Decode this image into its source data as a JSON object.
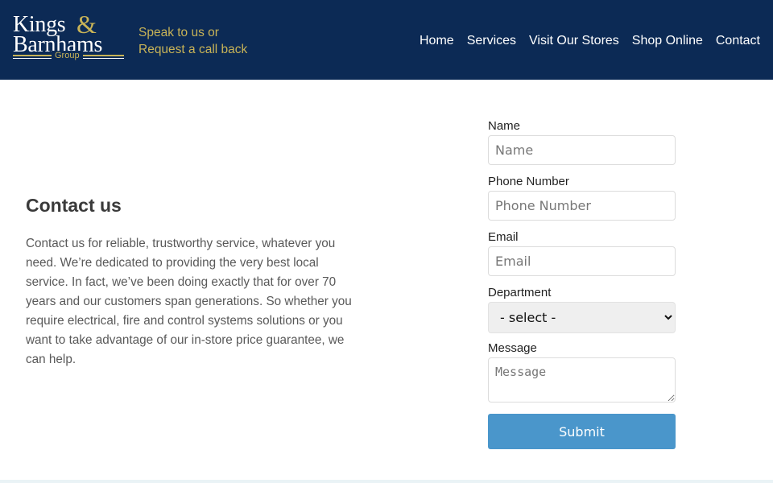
{
  "header": {
    "logo": {
      "line1": "Kings",
      "ampersand": "&",
      "line2": "Barnhams",
      "group": "Group"
    },
    "callback": {
      "line1": "Speak to us or",
      "line2": "Request a call back"
    },
    "nav": [
      {
        "label": "Home"
      },
      {
        "label": "Services"
      },
      {
        "label": "Visit Our Stores"
      },
      {
        "label": "Shop Online"
      },
      {
        "label": "Contact"
      }
    ]
  },
  "main": {
    "heading": "Contact us",
    "paragraph": "Contact us for reliable, trustworthy service, whatever you need. We’re dedicated to providing the very best local service. In fact, we’ve been doing exactly that for over 70 years and our customers span generations. So whether you require electrical, fire and control systems solutions or you want to take advantage of our in-store price guarantee, we can help."
  },
  "form": {
    "name": {
      "label": "Name",
      "placeholder": "Name",
      "value": ""
    },
    "phone": {
      "label": "Phone Number",
      "placeholder": "Phone Number",
      "value": ""
    },
    "email": {
      "label": "Email",
      "placeholder": "Email",
      "value": ""
    },
    "department": {
      "label": "Department",
      "selected": "- select -"
    },
    "message": {
      "label": "Message",
      "placeholder": "Message",
      "value": ""
    },
    "submit_label": "Submit"
  },
  "colors": {
    "header_bg": "#0c2a55",
    "gold_accent": "#c8b357",
    "submit_bg": "#4a96cb"
  }
}
